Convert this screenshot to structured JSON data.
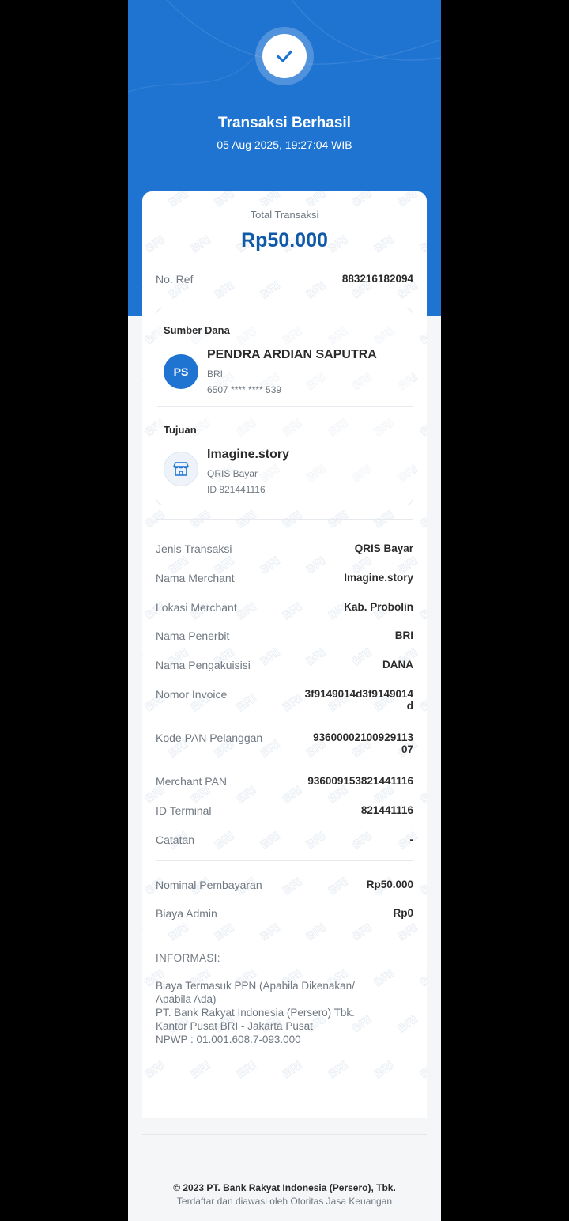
{
  "header": {
    "title": "Transaksi Berhasil",
    "datetime": "05 Aug 2025, 19:27:04 WIB",
    "accent_color": "#1f74d2"
  },
  "total": {
    "label": "Total Transaksi",
    "value": "Rp50.000"
  },
  "ref": {
    "label": "No. Ref",
    "value": "883216182094"
  },
  "source": {
    "heading": "Sumber Dana",
    "initials": "PS",
    "name": "PENDRA ARDIAN SAPUTRA",
    "bank": "BRI",
    "account": "6507 **** **** 539"
  },
  "destination": {
    "heading": "Tujuan",
    "icon": "store-icon",
    "name": "Imagine.story",
    "type": "QRIS Bayar",
    "id": "ID 821441116"
  },
  "details": [
    {
      "label": "Jenis Transaksi",
      "value": "QRIS Bayar"
    },
    {
      "label": "Nama Merchant",
      "value": "Imagine.story"
    },
    {
      "label": "Lokasi Merchant",
      "value": "Kab. Probolin"
    },
    {
      "label": "Nama Penerbit",
      "value": "BRI"
    },
    {
      "label": "Nama Pengakuisisi",
      "value": "DANA"
    },
    {
      "label": "Nomor Invoice",
      "value_lines": [
        "3f9149014d3f9149014",
        "d"
      ]
    },
    {
      "label": "Kode PAN Pelanggan",
      "value_lines": [
        "93600002100929113",
        "07"
      ]
    },
    {
      "label": "Merchant PAN",
      "value": "936009153821441116"
    },
    {
      "label": "ID Terminal",
      "value": "821441116"
    },
    {
      "label": "Catatan",
      "value": "-"
    }
  ],
  "payment": [
    {
      "label": "Nominal Pembayaran",
      "value": "Rp50.000"
    },
    {
      "label": "Biaya Admin",
      "value": "Rp0"
    }
  ],
  "info": {
    "title": "INFORMASI:",
    "lines": [
      "Biaya Termasuk PPN (Apabila Dikenakan/",
      "Apabila Ada)",
      "PT. Bank Rakyat Indonesia (Persero) Tbk.",
      "Kantor Pusat BRI - Jakarta Pusat",
      "NPWP : 01.001.608.7-093.000"
    ]
  },
  "watermark_text": "BRI",
  "footer": {
    "copyright": "© 2023 PT. Bank Rakyat Indonesia (Persero), Tbk.",
    "regulator": "Terdaftar dan diawasi oleh Otoritas Jasa Keuangan"
  }
}
